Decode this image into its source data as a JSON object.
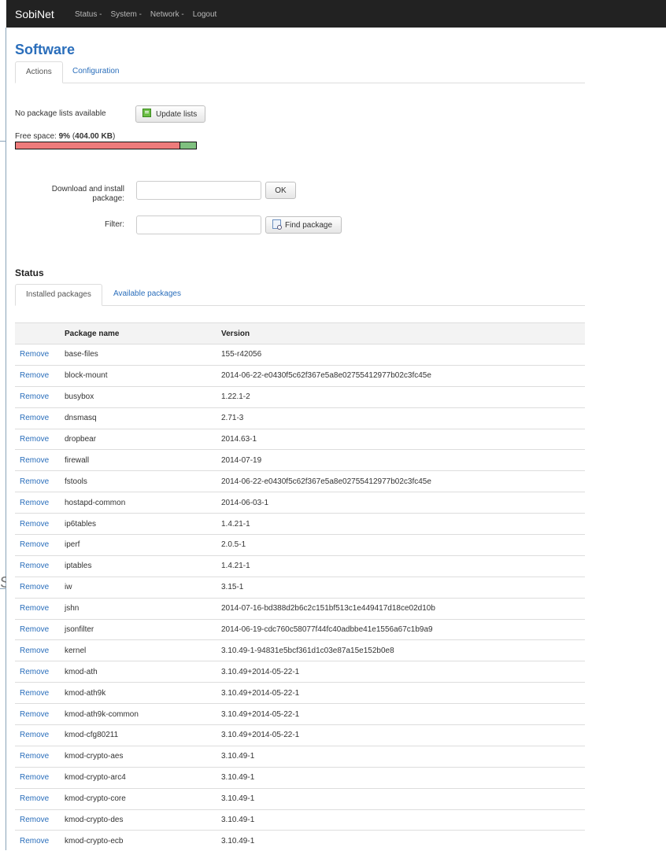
{
  "navbar": {
    "brand": "SobiNet",
    "menu": [
      "Status -",
      "System -",
      "Network -",
      "Logout"
    ]
  },
  "page": {
    "title": "Software",
    "tabs": [
      {
        "label": "Actions",
        "active": true
      },
      {
        "label": "Configuration",
        "active": false
      }
    ]
  },
  "actions": {
    "no_lists_text": "No package lists available",
    "update_button": "Update lists",
    "free_space_prefix": "Free space: ",
    "free_space_percent": "9%",
    "free_space_paren_open": " (",
    "free_space_size": "404.00 KB",
    "free_space_paren_close": ")",
    "free_space_fraction": 0.09,
    "download_label": "Download and install package:",
    "download_value": "",
    "ok_button": "OK",
    "filter_label": "Filter:",
    "filter_value": "",
    "find_button": "Find package"
  },
  "status": {
    "title": "Status",
    "tabs": [
      {
        "label": "Installed packages",
        "active": true
      },
      {
        "label": "Available packages",
        "active": false
      }
    ],
    "columns": [
      "",
      "Package name",
      "Version"
    ],
    "action_label": "Remove",
    "rows": [
      {
        "name": "base-files",
        "version": "155-r42056"
      },
      {
        "name": "block-mount",
        "version": "2014-06-22-e0430f5c62f367e5a8e02755412977b02c3fc45e"
      },
      {
        "name": "busybox",
        "version": "1.22.1-2"
      },
      {
        "name": "dnsmasq",
        "version": "2.71-3"
      },
      {
        "name": "dropbear",
        "version": "2014.63-1"
      },
      {
        "name": "firewall",
        "version": "2014-07-19"
      },
      {
        "name": "fstools",
        "version": "2014-06-22-e0430f5c62f367e5a8e02755412977b02c3fc45e"
      },
      {
        "name": "hostapd-common",
        "version": "2014-06-03-1"
      },
      {
        "name": "ip6tables",
        "version": "1.4.21-1"
      },
      {
        "name": "iperf",
        "version": "2.0.5-1"
      },
      {
        "name": "iptables",
        "version": "1.4.21-1"
      },
      {
        "name": "iw",
        "version": "3.15-1"
      },
      {
        "name": "jshn",
        "version": "2014-07-16-bd388d2b6c2c151bf513c1e449417d18ce02d10b"
      },
      {
        "name": "jsonfilter",
        "version": "2014-06-19-cdc760c58077f44fc40adbbe41e1556a67c1b9a9"
      },
      {
        "name": "kernel",
        "version": "3.10.49-1-94831e5bcf361d1c03e87a15e152b0e8"
      },
      {
        "name": "kmod-ath",
        "version": "3.10.49+2014-05-22-1"
      },
      {
        "name": "kmod-ath9k",
        "version": "3.10.49+2014-05-22-1"
      },
      {
        "name": "kmod-ath9k-common",
        "version": "3.10.49+2014-05-22-1"
      },
      {
        "name": "kmod-cfg80211",
        "version": "3.10.49+2014-05-22-1"
      },
      {
        "name": "kmod-crypto-aes",
        "version": "3.10.49-1"
      },
      {
        "name": "kmod-crypto-arc4",
        "version": "3.10.49-1"
      },
      {
        "name": "kmod-crypto-core",
        "version": "3.10.49-1"
      },
      {
        "name": "kmod-crypto-des",
        "version": "3.10.49-1"
      },
      {
        "name": "kmod-crypto-ecb",
        "version": "3.10.49-1"
      }
    ]
  },
  "edge_glyph": "S",
  "colors": {
    "navbar": "#222222",
    "link": "#2a6ebb",
    "bar_used": "#ee7b7b",
    "bar_free": "#7fc07f"
  }
}
